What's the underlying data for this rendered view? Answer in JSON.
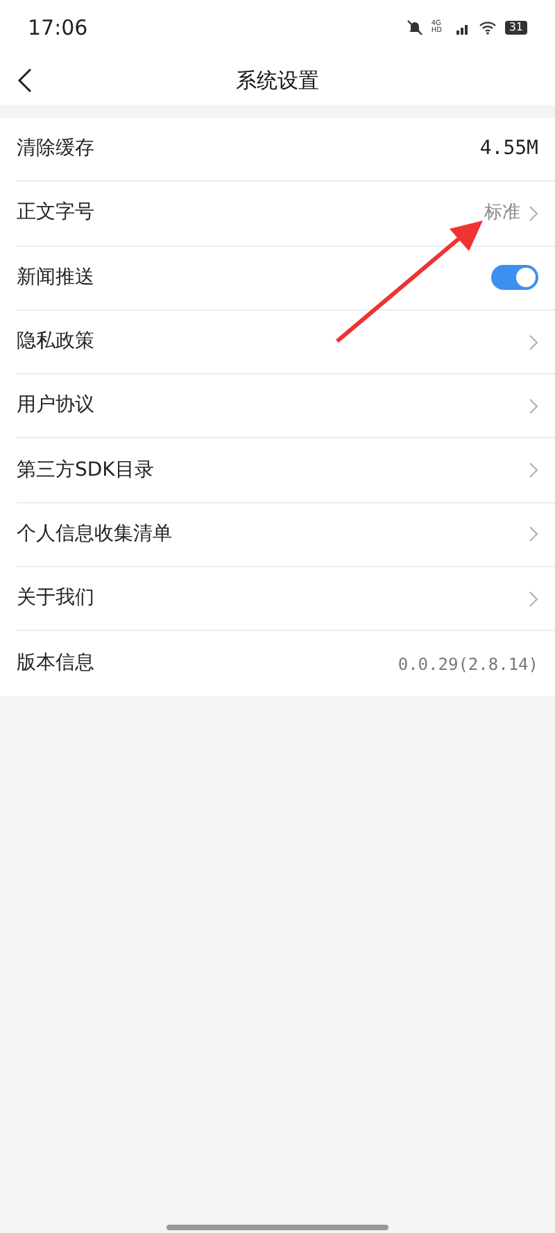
{
  "status_bar": {
    "time": "17:06",
    "network": "4G HD",
    "battery": "31"
  },
  "header": {
    "title": "系统设置"
  },
  "rows": [
    {
      "label": "清除缓存",
      "kind": "value",
      "value": "4.55M"
    },
    {
      "label": "正文字号",
      "kind": "link",
      "value": "标准"
    },
    {
      "label": "新闻推送",
      "kind": "toggle",
      "on": true
    },
    {
      "label": "隐私政策",
      "kind": "link"
    },
    {
      "label": "用户协议",
      "kind": "link"
    },
    {
      "label": "第三方SDK目录",
      "kind": "link"
    },
    {
      "label": "个人信息收集清单",
      "kind": "link"
    },
    {
      "label": "关于我们",
      "kind": "link"
    },
    {
      "label": "版本信息",
      "kind": "version",
      "value": "0.0.29(2.8.14)"
    }
  ]
}
